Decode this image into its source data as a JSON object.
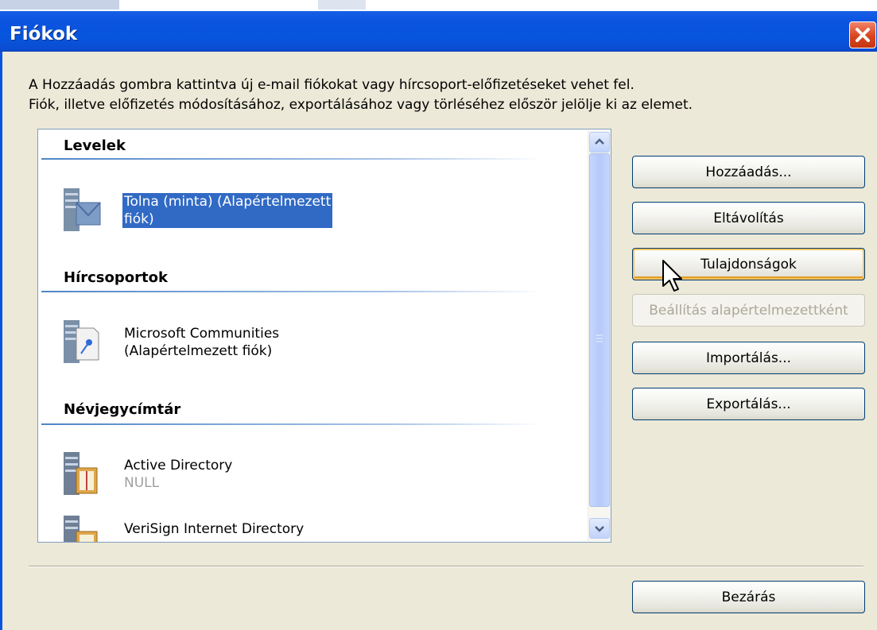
{
  "window": {
    "title": "Fiókok"
  },
  "description": {
    "line1": "A Hozzáadás gombra kattintva új e-mail fiókokat vagy hírcsoport-előfizetéseket vehet fel.",
    "line2": "Fiók, illetve előfizetés módosításához, exportálásához vagy törléséhez először jelölje ki az elemet."
  },
  "list": {
    "groups": [
      {
        "header": "Levelek",
        "items": [
          {
            "line1": "Tolna (minta) (Alapértelmezett",
            "line2": "fiók)",
            "icon": "mail-server-icon",
            "selected": true
          }
        ]
      },
      {
        "header": "Hírcsoportok",
        "items": [
          {
            "line1": "Microsoft Communities",
            "line2": "(Alapértelmezett fiók)",
            "icon": "news-server-icon"
          }
        ]
      },
      {
        "header": "Névjegycímtár",
        "items": [
          {
            "line1": "Active Directory",
            "line2": "NULL",
            "icon": "directory-server-icon"
          },
          {
            "line1": "VeriSign Internet Directory",
            "icon": "directory-server-icon"
          }
        ]
      }
    ]
  },
  "buttons": {
    "add": "Hozzáadás...",
    "remove": "Eltávolítás",
    "properties": "Tulajdonságok",
    "set_default": "Beállítás alapértelmezettként",
    "import": "Importálás...",
    "export": "Exportálás...",
    "close": "Bezárás"
  },
  "colors": {
    "titlebar": "#0a54e0",
    "selection": "#316ac5",
    "dialog_bg": "#ece9d8",
    "close_button": "#d8451e"
  }
}
